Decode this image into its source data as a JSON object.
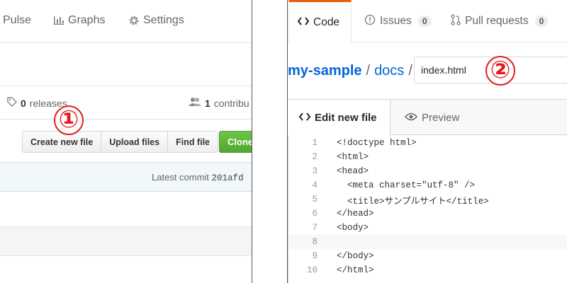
{
  "left": {
    "nav": [
      {
        "label": "Pulse",
        "icon": "pulse-icon"
      },
      {
        "label": "Graphs",
        "icon": "graph-icon"
      },
      {
        "label": "Settings",
        "icon": "gear-icon"
      }
    ],
    "stats": {
      "releases_count": "0",
      "releases_label": "releases",
      "contributors_count": "1",
      "contributors_label": "contribu"
    },
    "buttons": [
      "Create new file",
      "Upload files",
      "Find file"
    ],
    "clone_label": "Clone",
    "commit": {
      "prefix": "Latest commit ",
      "sha": "201afd"
    },
    "marker": "①"
  },
  "right": {
    "tabs": [
      {
        "label": "Code",
        "icon": "code-icon"
      },
      {
        "label": "Issues",
        "count": "0",
        "icon": "issue-icon"
      },
      {
        "label": "Pull requests",
        "count": "0",
        "icon": "pull-request-icon"
      }
    ],
    "breadcrumb": {
      "repo": "my-sample",
      "sep1": "/",
      "dir": "docs",
      "sep2": "/"
    },
    "filename_value": "index.html",
    "marker": "②",
    "editor_tabs": {
      "edit": "Edit new file",
      "preview": "Preview"
    },
    "code_lines": [
      {
        "n": "1",
        "text": "<!doctype html>"
      },
      {
        "n": "2",
        "text": "<html>"
      },
      {
        "n": "3",
        "text": "<head>"
      },
      {
        "n": "4",
        "text": "  <meta charset=\"utf-8\" />"
      },
      {
        "n": "5",
        "text": "  <title>サンプルサイト</title>"
      },
      {
        "n": "6",
        "text": "</head>"
      },
      {
        "n": "7",
        "text": "<body>"
      },
      {
        "n": "8",
        "text": ""
      },
      {
        "n": "9",
        "text": "</body>"
      },
      {
        "n": "10",
        "text": "</html>"
      }
    ]
  },
  "colors": {
    "accent_orange": "#e36209",
    "link_blue": "#0366d6",
    "clone_green": "#55a532",
    "marker_red": "#e41b1b"
  }
}
